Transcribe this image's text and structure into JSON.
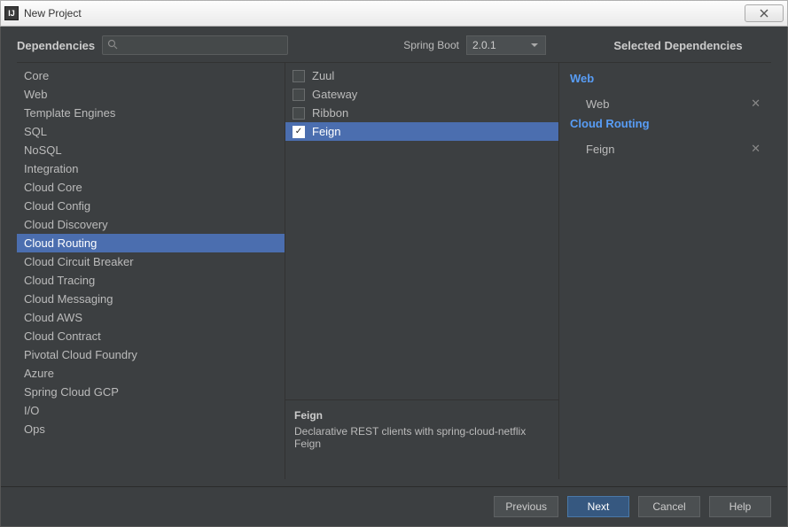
{
  "window": {
    "title": "New Project"
  },
  "header": {
    "dependencies": "Dependencies",
    "selected": "Selected Dependencies"
  },
  "springboot": {
    "label": "Spring Boot",
    "value": "2.0.1"
  },
  "search": {
    "placeholder": ""
  },
  "categories": [
    "Core",
    "Web",
    "Template Engines",
    "SQL",
    "NoSQL",
    "Integration",
    "Cloud Core",
    "Cloud Config",
    "Cloud Discovery",
    "Cloud Routing",
    "Cloud Circuit Breaker",
    "Cloud Tracing",
    "Cloud Messaging",
    "Cloud AWS",
    "Cloud Contract",
    "Pivotal Cloud Foundry",
    "Azure",
    "Spring Cloud GCP",
    "I/O",
    "Ops"
  ],
  "selectedCategoryIndex": 9,
  "deps": [
    {
      "name": "Zuul",
      "checked": false
    },
    {
      "name": "Gateway",
      "checked": false
    },
    {
      "name": "Ribbon",
      "checked": false
    },
    {
      "name": "Feign",
      "checked": true
    }
  ],
  "selectedDepIndex": 3,
  "desc": {
    "title": "Feign",
    "body": "Declarative REST clients with spring-cloud-netflix Feign"
  },
  "selected": [
    {
      "group": "Web",
      "items": [
        "Web"
      ]
    },
    {
      "group": "Cloud Routing",
      "items": [
        "Feign"
      ]
    }
  ],
  "buttons": {
    "previous": "Previous",
    "next": "Next",
    "cancel": "Cancel",
    "help": "Help"
  }
}
